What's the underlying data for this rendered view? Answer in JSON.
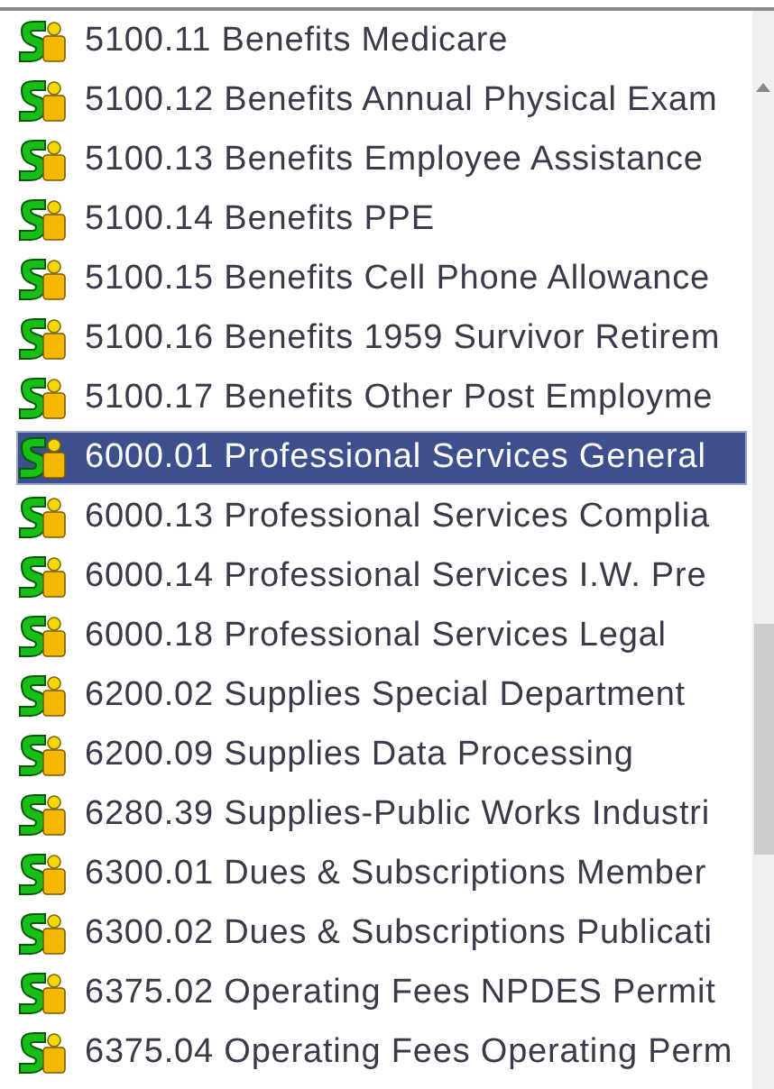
{
  "accounts": [
    {
      "label": "5100.11 Benefits Medicare",
      "selected": false
    },
    {
      "label": "5100.12 Benefits Annual Physical Exam",
      "selected": false
    },
    {
      "label": "5100.13 Benefits Employee Assistance",
      "selected": false
    },
    {
      "label": "5100.14 Benefits PPE",
      "selected": false
    },
    {
      "label": "5100.15 Benefits Cell Phone Allowance",
      "selected": false
    },
    {
      "label": "5100.16 Benefits 1959 Survivor Retirem",
      "selected": false
    },
    {
      "label": "5100.17 Benefits Other Post Employme",
      "selected": false
    },
    {
      "label": "6000.01 Professional Services General",
      "selected": true
    },
    {
      "label": "6000.13 Professional Services Complia",
      "selected": false
    },
    {
      "label": "6000.14 Professional Services I.W. Pre",
      "selected": false
    },
    {
      "label": "6000.18 Professional Services Legal",
      "selected": false
    },
    {
      "label": "6200.02 Supplies Special Department",
      "selected": false
    },
    {
      "label": "6200.09 Supplies Data Processing",
      "selected": false
    },
    {
      "label": "6280.39 Supplies-Public Works Industri",
      "selected": false
    },
    {
      "label": "6300.01 Dues & Subscriptions Member",
      "selected": false
    },
    {
      "label": "6300.02 Dues & Subscriptions Publicati",
      "selected": false
    },
    {
      "label": "6375.02 Operating Fees NPDES Permit",
      "selected": false
    },
    {
      "label": "6375.04 Operating Fees Operating Perm",
      "selected": false
    }
  ]
}
